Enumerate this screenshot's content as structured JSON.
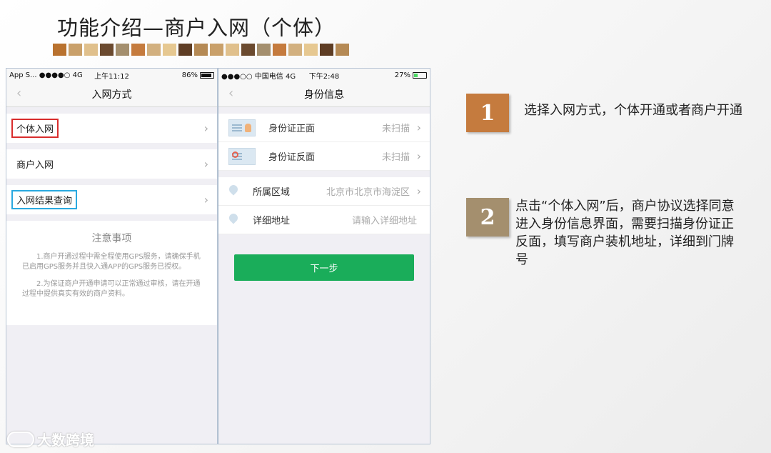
{
  "slide": {
    "title": "功能介绍—商户入网（个体）",
    "decor_colors": [
      "#b9722f",
      "#c9a06a",
      "#e0c08c",
      "#6b4a2f",
      "#a48f6e",
      "#c57b3e",
      "#d2b07f",
      "#e6c891",
      "#5e3d24",
      "#b58a55",
      "#c9a06a",
      "#e0c08c",
      "#6b4a2f",
      "#a48f6e",
      "#c57b3e",
      "#d2b07f",
      "#e6c891",
      "#5e3d24",
      "#b58a55"
    ]
  },
  "phone1": {
    "status": {
      "left": "App S... ●●●●○ 4G",
      "time": "上午11:12",
      "right": "86%"
    },
    "nav_title": "入网方式",
    "items": [
      "个体入网",
      "商户入网",
      "入网结果查询"
    ],
    "notice_title": "注意事项",
    "notice_lines": [
      "1.商户开通过程中需全程使用GPS服务，请确保手机已启用GPS服务并且快入通APP的GPS服务已授权。",
      "2.为保证商户开通申请可以正常通过审核，请在开通过程中提供真实有效的商户资料。"
    ]
  },
  "phone2": {
    "status": {
      "left": "●●●○○ 中国电信 4G",
      "time": "下午2:48",
      "right": "27%"
    },
    "nav_title": "身份信息",
    "id_front": {
      "label": "身份证正面",
      "value": "未扫描"
    },
    "id_back": {
      "label": "身份证反面",
      "value": "未扫描"
    },
    "region": {
      "label": "所属区域",
      "value": "北京市北京市海淀区"
    },
    "address": {
      "label": "详细地址",
      "placeholder": "请输入详细地址"
    },
    "next_button": "下一步"
  },
  "steps": [
    {
      "number": "1",
      "text": "选择入网方式，个体开通或者商户开通"
    },
    {
      "number": "2",
      "text": "点击“个体入网”后，商户协议选择同意进入身份信息界面，需要扫描身份证正反面，填写商户装机地址，详细到门牌号"
    }
  ],
  "watermark": "大数跨境"
}
